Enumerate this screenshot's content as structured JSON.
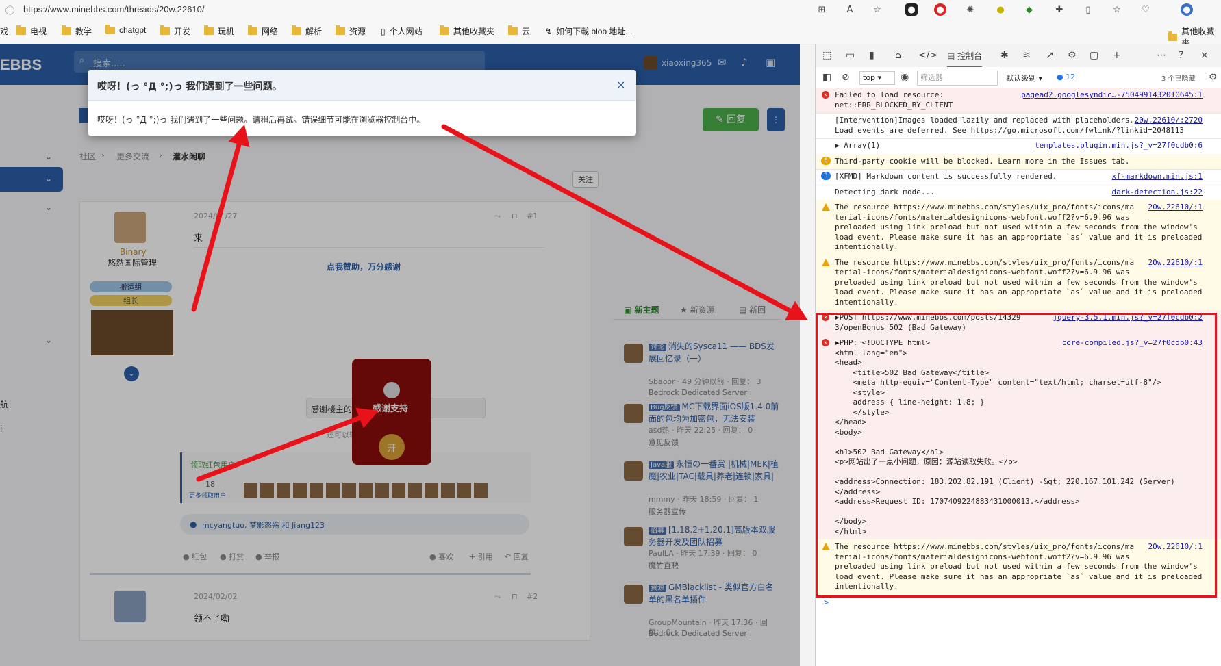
{
  "browser": {
    "url": "https://www.minebbs.com/threads/20w.22610/",
    "bookmarks": [
      "戏",
      "电视",
      "教学",
      "chatgpt",
      "开发",
      "玩机",
      "网络",
      "解析",
      "资源",
      "个人网站",
      "其他收藏夹",
      "云",
      "如何下載 blob 地址...",
      "其他收藏夹"
    ]
  },
  "site": {
    "logo": "EBBS",
    "search_placeholder": "搜索.....",
    "username": "xiaoxing365",
    "breadcrumb": [
      "社区",
      "更多交流",
      "灌水闲聊"
    ],
    "follow_label": "关注",
    "reply_label": "回复",
    "sidebar_labels": [
      "航",
      "i"
    ]
  },
  "modal": {
    "title": "哎呀！(っ °Д °;)っ 我们遇到了一些问题。",
    "message": "哎呀！(っ °Д °;)っ 我们遇到了一些问题。请稍后再试。错误细节可能在浏览器控制台中。",
    "close": "×"
  },
  "post1": {
    "author": "Binary",
    "role": "悠然国际管理",
    "badges": [
      "搬运组",
      "组长"
    ],
    "date": "2024/01/27",
    "number": "#1",
    "content": "来",
    "thanks": "点我赞助，万分感谢",
    "envelope_label": "感谢支持",
    "envelope_open": "开",
    "comment_value": "感谢楼主的红包!",
    "chars_left": "还可以输入20字数。",
    "receivers_title": "领取红包用户",
    "receivers_count": "18",
    "receivers_more": "更多领取用户",
    "likes": "mcyangtuo, 梦影怒殇 和 Jiang123",
    "actions_left": [
      "红包",
      "打赏",
      "举报"
    ],
    "actions_right": [
      "喜欢",
      "+ 引用",
      "回复"
    ]
  },
  "post2": {
    "date": "2024/02/02",
    "number": "#2",
    "content": "领不了嘞"
  },
  "right_tabs": [
    "新主题",
    "新资源",
    "新回"
  ],
  "threads": [
    {
      "tag": "讨论",
      "title": "消失的Sysca11 —— BDS发展回忆录（一）",
      "meta": "Sbaoor · 49 分钟以前 · 回复： 3",
      "forum": "Bedrock Dedicated Server"
    },
    {
      "tag": "Bug反馈",
      "title": "MC下载界面iOS版1.4.0前面的包均为加密包，无法安装",
      "meta": "asd热 · 昨天 22:25 · 回复： 0",
      "forum": "意见反馈"
    },
    {
      "tag": "Java服",
      "title": "永恒の一番赏 |机械|MEK|植魔|农业|TAC|载具|养老|连锁|家具|",
      "meta": "mmmy · 昨天 18:59 · 回复： 1",
      "forum": "服务器宣传"
    },
    {
      "tag": "招募",
      "title": "[1.18.2+1.20.1]高版本双服务器开发及团队招募",
      "meta": "PaulLA · 昨天 17:39 · 回复： 0",
      "forum": "魔竹直聘"
    },
    {
      "tag": "资源",
      "title": "GMBlacklist - 类似官方白名单的黑名单插件",
      "meta": "GroupMountain · 昨天 17:36 · 回复： 0",
      "forum": "Bedrock Dedicated Server"
    }
  ],
  "devtools": {
    "tab_console": "控制台",
    "context": "top",
    "filter_placeholder": "筛选器",
    "level": "默认级别",
    "issues_count": "12",
    "hidden": "3 个已隐藏",
    "messages": [
      {
        "kind": "error",
        "text": "Failed to load resource:\nnet::ERR_BLOCKED_BY_CLIENT",
        "src": "pagead2.googlesyndic…-7504991432010645:1"
      },
      {
        "kind": "info",
        "text": "[Intervention]Images loaded lazily and replaced with placeholders.\nLoad events are deferred. See https://go.microsoft.com/fwlink/?linkid=2048113",
        "src": "20w.22610/:2720"
      },
      {
        "kind": "info",
        "text": "▶ Array(1)",
        "src": "templates.plugin.min.js?_v=27f0cdb0:6"
      },
      {
        "kind": "warnbadge",
        "badge": "6",
        "text": "Third-party cookie will be blocked. Learn more in the Issues tab.",
        "src": ""
      },
      {
        "kind": "info3",
        "badge": "3",
        "text": "[XFMD] Markdown content is successfully rendered.",
        "src": "xf-markdown.min.js:1"
      },
      {
        "kind": "info",
        "text": "Detecting dark mode...",
        "src": "dark-detection.js:22"
      },
      {
        "kind": "warning",
        "text": "The resource https://www.minebbs.com/styles/uix_pro/fonts/icons/ma\nterial-icons/fonts/materialdesignicons-webfont.woff2?v=6.9.96 was\npreloaded using link preload but not used within a few seconds from the window's\nload event. Please make sure it has an appropriate `as` value and it is preloaded\nintentionally.",
        "src": "20w.22610/:1"
      },
      {
        "kind": "warning",
        "text": "The resource https://www.minebbs.com/styles/uix_pro/fonts/icons/ma\nterial-icons/fonts/materialdesignicons-webfont.woff2?v=6.9.96 was\npreloaded using link preload but not used within a few seconds from the window's\nload event. Please make sure it has an appropriate `as` value and it is preloaded\nintentionally.",
        "src": "20w.22610/:1"
      },
      {
        "kind": "error",
        "text": "▶POST https://www.minebbs.com/posts/14329\n3/openBonus 502 (Bad Gateway)",
        "src": "jquery-3.5.1.min.js?_v=27f0cdb0:2"
      },
      {
        "kind": "error",
        "text": "▶PHP: <!DOCTYPE html>\n<html lang=\"en\">\n<head>\n    <title>502 Bad Gateway</title>\n    <meta http-equiv=\"Content-Type\" content=\"text/html; charset=utf-8\"/>\n    <style>\n    address { line-height: 1.8; }\n    </style>\n</head>\n<body>\n\n<h1>502 Bad Gateway</h1>\n<p>网站出了一点小问题，原因：源站读取失败。</p>\n\n<address>Connection: 183.202.82.191 (Client) -&gt; 220.167.101.242 (Server)\n</address>\n<address>Request ID: 1707409224883431000013.</address>\n\n</body>\n</html>",
        "src": "core-compiled.js?_v=27f0cdb0:43"
      },
      {
        "kind": "warning",
        "text": "The resource https://www.minebbs.com/styles/uix_pro/fonts/icons/ma\nterial-icons/fonts/materialdesignicons-webfont.woff2?v=6.9.96 was\npreloaded using link preload but not used within a few seconds from the window's\nload event. Please make sure it has an appropriate `as` value and it is preloaded\nintentionally.",
        "src": "20w.22610/:1"
      }
    ],
    "prompt": ">"
  },
  "colors": {
    "annotation": "#e8131a",
    "nav": "#2b5fa8",
    "envelope": "#8b0c0c"
  }
}
